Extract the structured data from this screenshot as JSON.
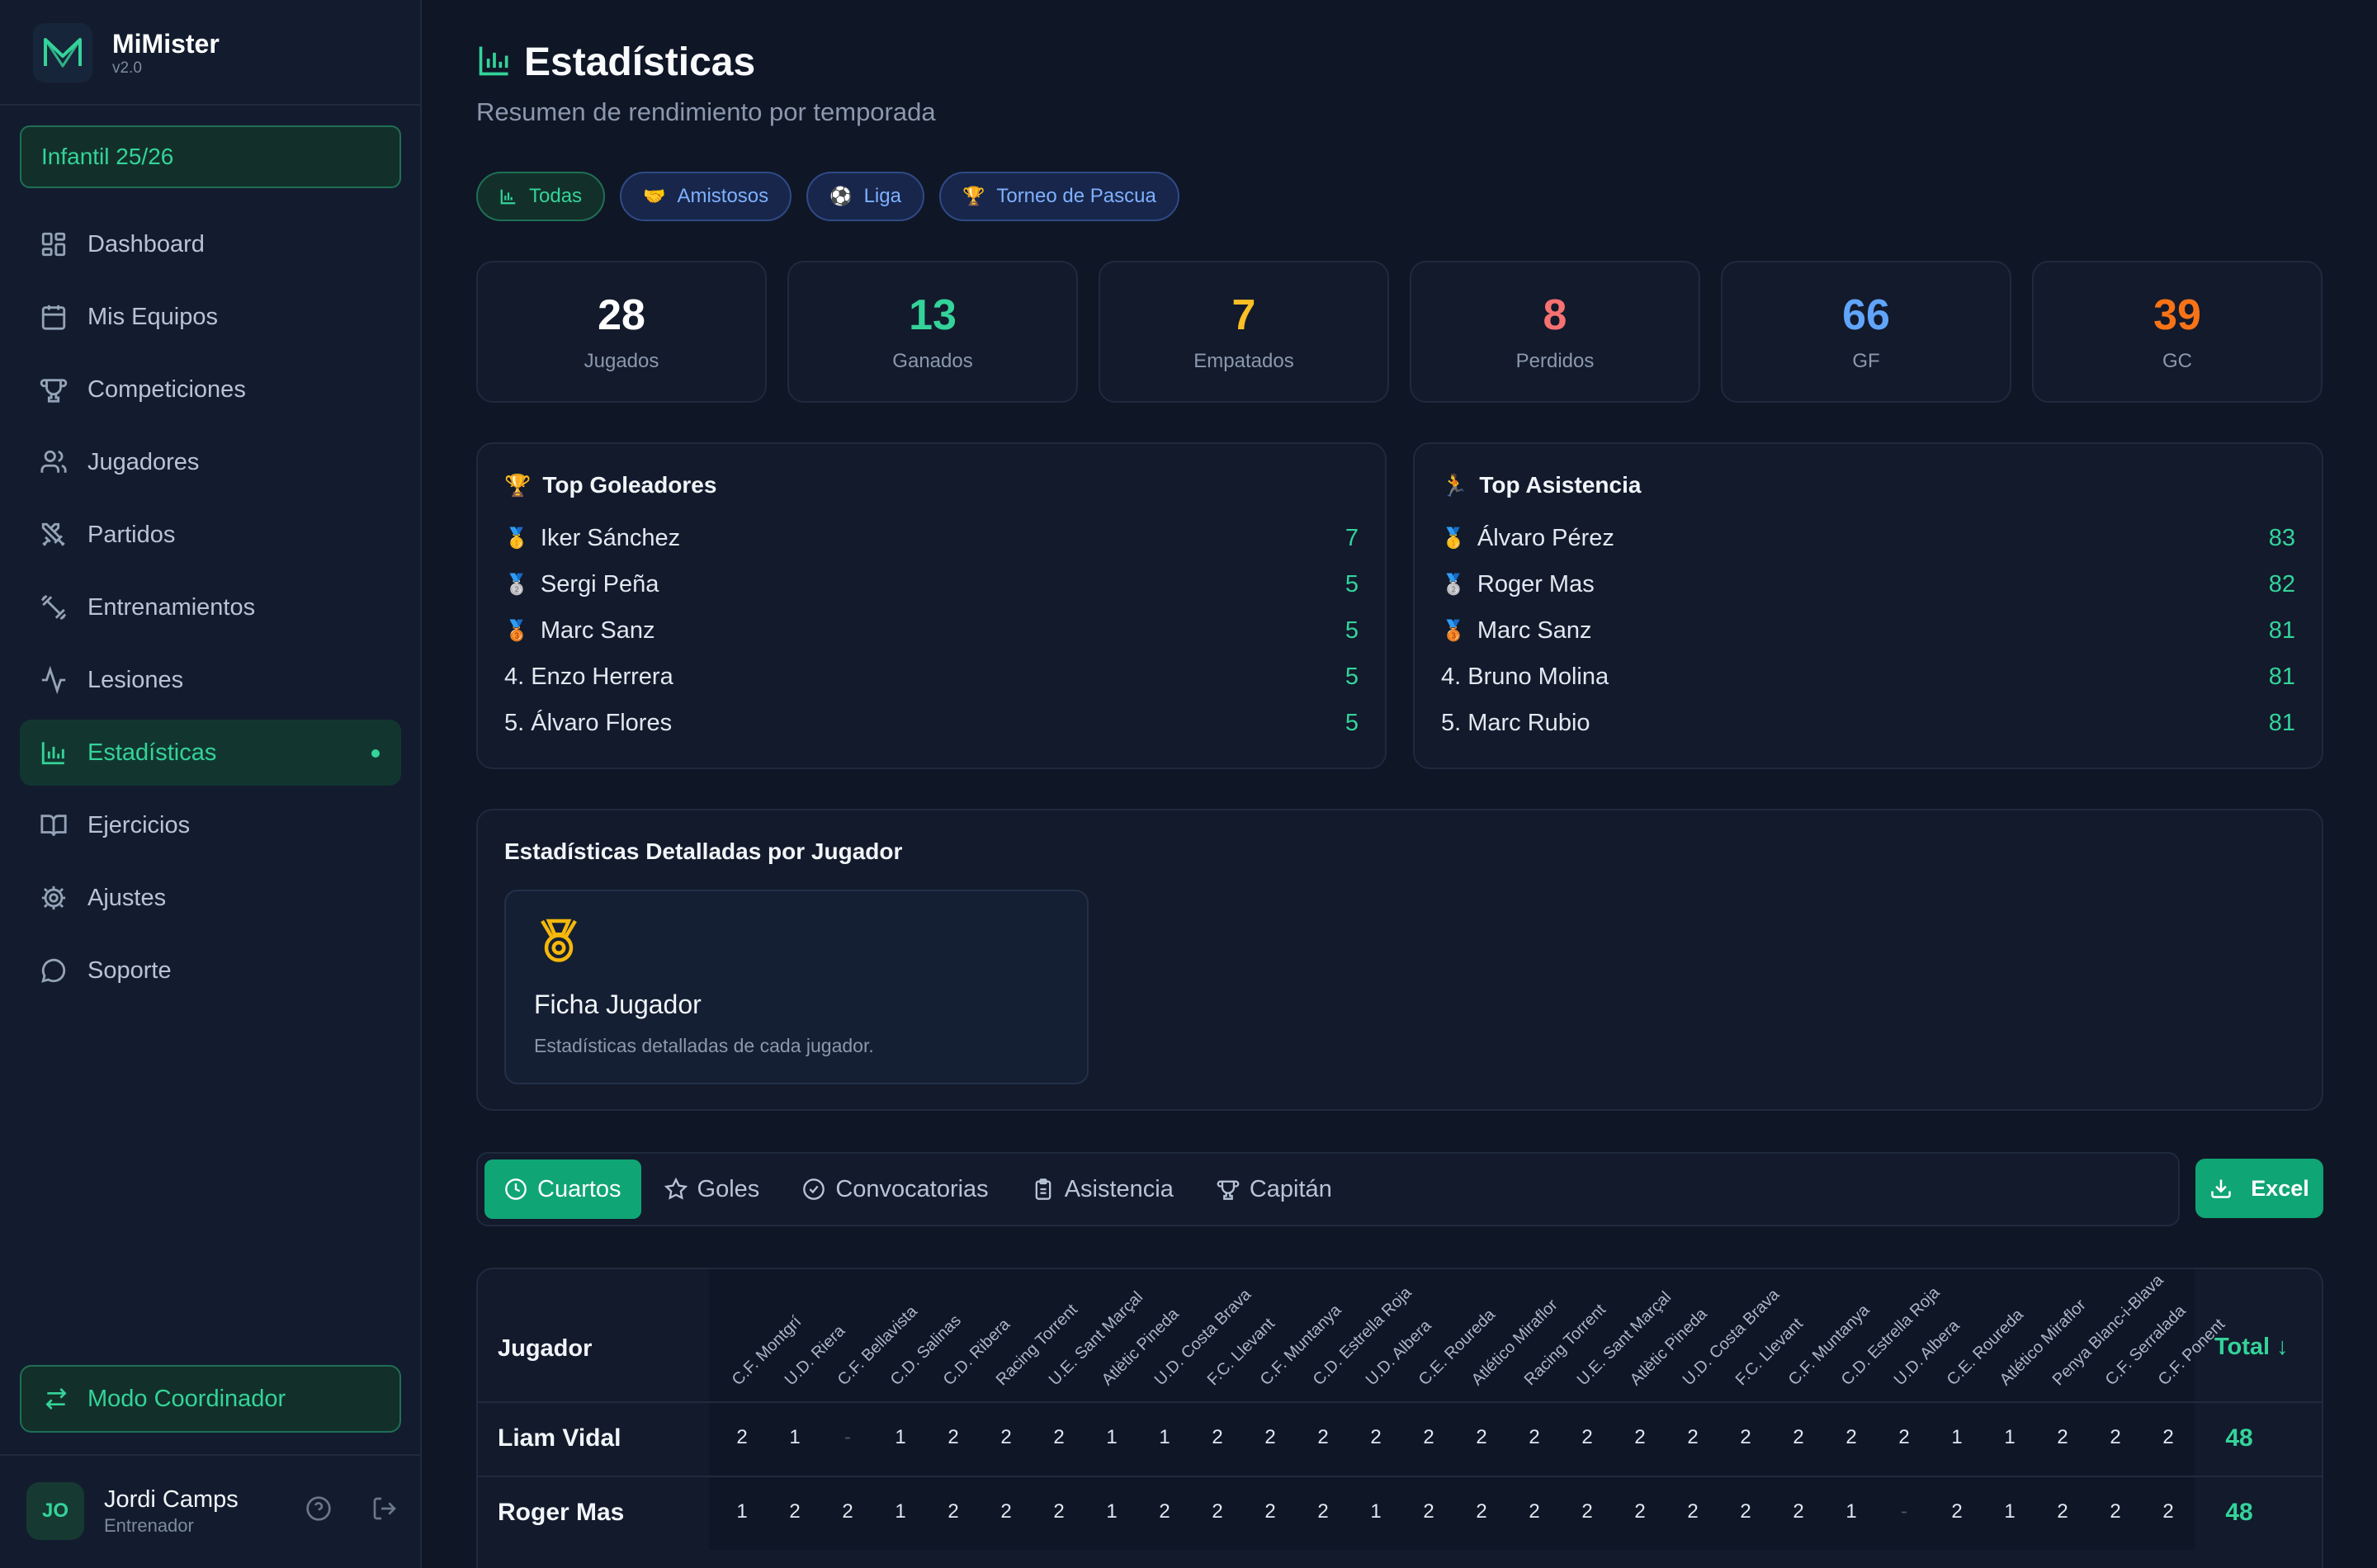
{
  "app": {
    "name": "MiMister",
    "version": "v2.0"
  },
  "season": "Infantil 25/26",
  "sidebar": {
    "items": [
      {
        "label": "Dashboard",
        "icon": "dashboard-icon"
      },
      {
        "label": "Mis Equipos",
        "icon": "calendar-icon"
      },
      {
        "label": "Competiciones",
        "icon": "trophy-icon"
      },
      {
        "label": "Jugadores",
        "icon": "users-icon"
      },
      {
        "label": "Partidos",
        "icon": "swords-icon"
      },
      {
        "label": "Entrenamientos",
        "icon": "dumbbell-icon"
      },
      {
        "label": "Lesiones",
        "icon": "activity-icon"
      },
      {
        "label": "Estadísticas",
        "icon": "bar-chart-icon",
        "active": true
      },
      {
        "label": "Ejercicios",
        "icon": "book-icon"
      },
      {
        "label": "Ajustes",
        "icon": "gear-icon"
      },
      {
        "label": "Soporte",
        "icon": "chat-icon"
      }
    ],
    "coordinator_label": "Modo Coordinador"
  },
  "user": {
    "initials": "JO",
    "name": "Jordi Camps",
    "role": "Entrenador"
  },
  "page": {
    "title": "Estadísticas",
    "subtitle": "Resumen de rendimiento por temporada"
  },
  "filters": [
    {
      "label": "Todas",
      "icon": "📊",
      "active": true
    },
    {
      "label": "Amistosos",
      "icon": "🤝"
    },
    {
      "label": "Liga",
      "icon": "⚽"
    },
    {
      "label": "Torneo de Pascua",
      "icon": "🏆"
    }
  ],
  "stats": [
    {
      "value": "28",
      "label": "Jugados",
      "color": "#ffffff"
    },
    {
      "value": "13",
      "label": "Ganados",
      "color": "#34d399"
    },
    {
      "value": "7",
      "label": "Empatados",
      "color": "#fbbf24"
    },
    {
      "value": "8",
      "label": "Perdidos",
      "color": "#f87171"
    },
    {
      "value": "66",
      "label": "GF",
      "color": "#60a5fa"
    },
    {
      "value": "39",
      "label": "GC",
      "color": "#f97316"
    }
  ],
  "top_scorers": {
    "title": "Top Goleadores",
    "icon": "🏆",
    "rows": [
      {
        "medal": "🥇",
        "name": "Iker Sánchez",
        "value": "7"
      },
      {
        "medal": "🥈",
        "name": "Sergi Peña",
        "value": "5"
      },
      {
        "medal": "🥉",
        "name": "Marc Sanz",
        "value": "5"
      },
      {
        "medal": "",
        "name": "4. Enzo Herrera",
        "value": "5"
      },
      {
        "medal": "",
        "name": "5. Álvaro Flores",
        "value": "5"
      }
    ]
  },
  "top_attendance": {
    "title": "Top Asistencia",
    "icon": "🏃",
    "rows": [
      {
        "medal": "🥇",
        "name": "Álvaro Pérez",
        "value": "83"
      },
      {
        "medal": "🥈",
        "name": "Roger Mas",
        "value": "82"
      },
      {
        "medal": "🥉",
        "name": "Marc Sanz",
        "value": "81"
      },
      {
        "medal": "",
        "name": "4. Bruno Molina",
        "value": "81"
      },
      {
        "medal": "",
        "name": "5. Marc Rubio",
        "value": "81"
      }
    ]
  },
  "detail": {
    "title": "Estadísticas Detalladas por Jugador",
    "card_name": "Ficha Jugador",
    "card_desc": "Estadísticas detalladas de cada jugador."
  },
  "tabs": [
    {
      "label": "Cuartos",
      "active": true
    },
    {
      "label": "Goles"
    },
    {
      "label": "Convocatorias"
    },
    {
      "label": "Asistencia"
    },
    {
      "label": "Capitán"
    }
  ],
  "excel_label": "Excel",
  "table": {
    "player_header": "Jugador",
    "total_header": "Total ↓",
    "columns": [
      "C.F. Montgrí",
      "U.D. Riera",
      "C.F. Bellavista",
      "C.D. Salinas",
      "C.D. Ribera",
      "Racing Torrent",
      "U.E. Sant Marçal",
      "Atlètic Pineda",
      "U.D. Costa Brava",
      "F.C. Llevant",
      "C.F. Muntanya",
      "C.D. Estrella Roja",
      "U.D. Albera",
      "C.E. Roureda",
      "Atlético Miraflor",
      "Racing Torrent",
      "U.E. Sant Marçal",
      "Atlètic Pineda",
      "U.D. Costa Brava",
      "F.C. Llevant",
      "C.F. Muntanya",
      "C.D. Estrella Roja",
      "U.D. Albera",
      "C.E. Roureda",
      "Atlético Miraflor",
      "Penya Blanc-i-Blava",
      "C.F. Serralada",
      "C.F. Ponent"
    ],
    "rows": [
      {
        "name": "Liam Vidal",
        "values": [
          "2",
          "1",
          "-",
          "1",
          "2",
          "2",
          "2",
          "1",
          "1",
          "2",
          "2",
          "2",
          "2",
          "2",
          "2",
          "2",
          "2",
          "2",
          "2",
          "2",
          "2",
          "2",
          "2",
          "1",
          "1",
          "2",
          "2",
          "2"
        ],
        "total": "48"
      },
      {
        "name": "Roger Mas",
        "values": [
          "1",
          "2",
          "2",
          "1",
          "2",
          "2",
          "2",
          "1",
          "2",
          "2",
          "2",
          "2",
          "1",
          "2",
          "2",
          "2",
          "2",
          "2",
          "2",
          "2",
          "2",
          "1",
          "-",
          "2",
          "1",
          "2",
          "2",
          "2"
        ],
        "total": "48"
      }
    ]
  }
}
